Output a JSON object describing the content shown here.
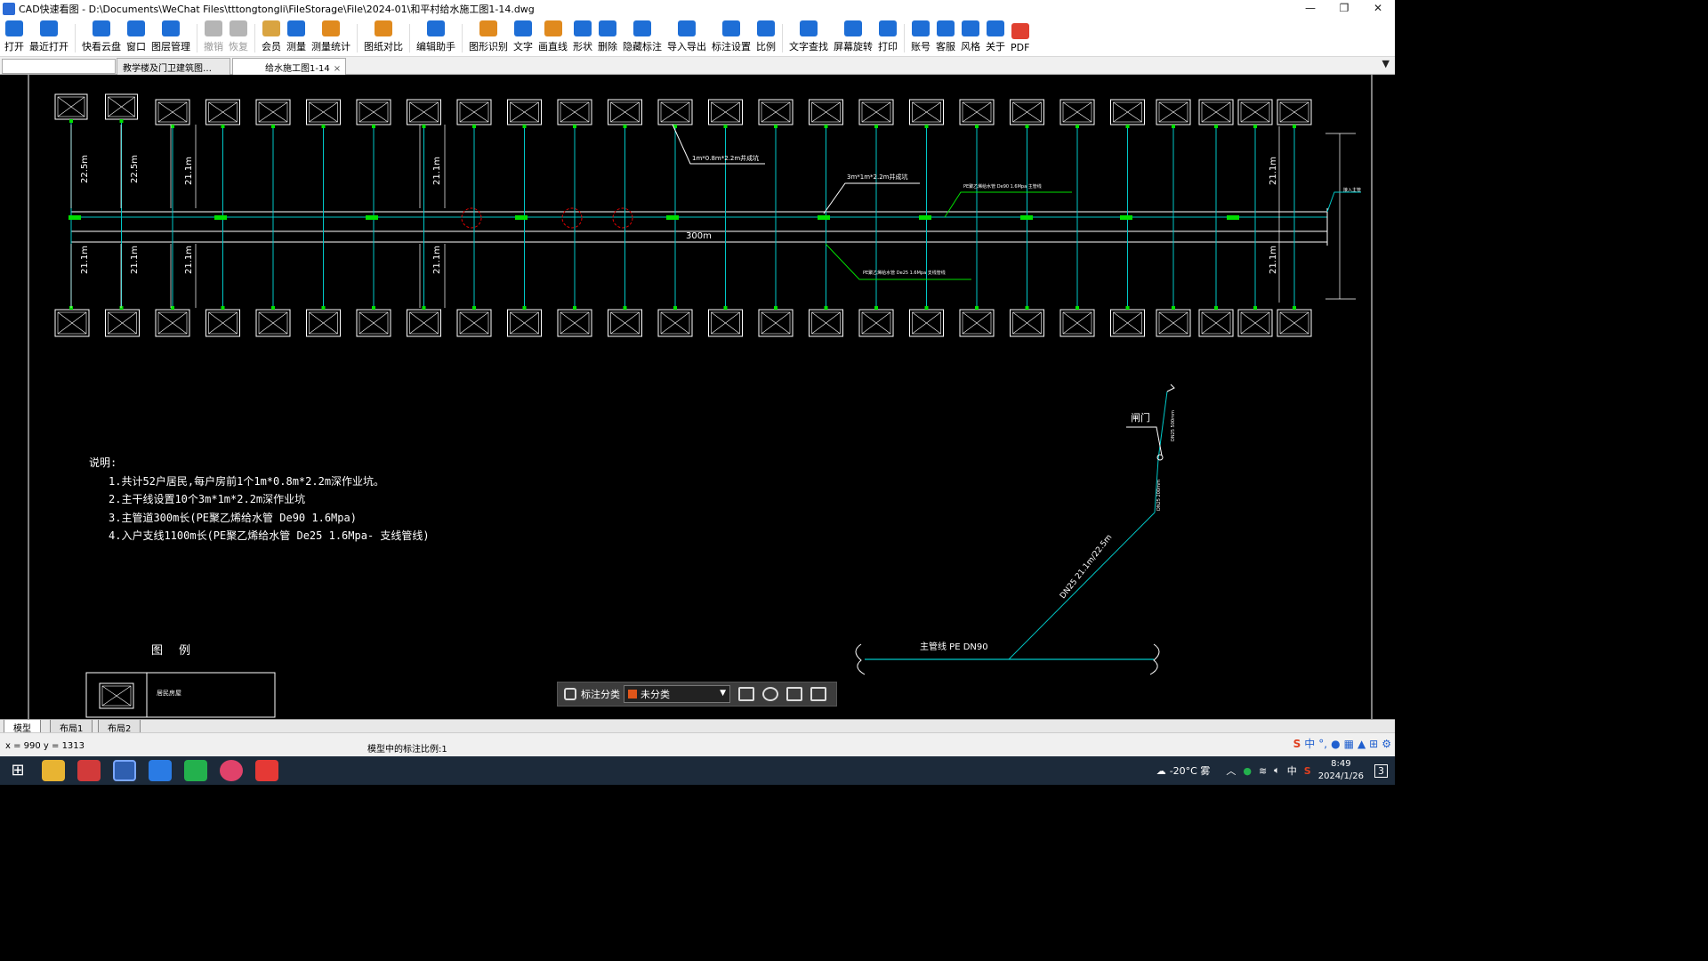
{
  "window": {
    "title": "CAD快速看图 - D:\\Documents\\WeChat Files\\tttongtongli\\FileStorage\\File\\2024-01\\和平村给水施工图1-14.dwg",
    "buttons": [
      "—",
      "❐",
      "✕"
    ]
  },
  "toolbar": [
    {
      "label": "打开",
      "icon": "open-folder-icon",
      "color": "#1e6ed6"
    },
    {
      "label": "最近打开",
      "icon": "recent-clock-icon",
      "color": "#1e6ed6"
    },
    {
      "label": "快看云盘",
      "icon": "cloud-icon",
      "color": "#1e6ed6"
    },
    {
      "label": "窗口",
      "icon": "window-icon",
      "color": "#1e6ed6"
    },
    {
      "label": "图层管理",
      "icon": "layers-icon",
      "color": "#1e6ed6"
    },
    {
      "label": "撤销",
      "icon": "undo-icon",
      "color": "#b5b5b5",
      "disabled": true
    },
    {
      "label": "恢复",
      "icon": "redo-icon",
      "color": "#b5b5b5",
      "disabled": true
    },
    {
      "label": "会员",
      "icon": "vip-icon",
      "color": "#d9a441"
    },
    {
      "label": "测量",
      "icon": "measure-icon",
      "color": "#1e6ed6"
    },
    {
      "label": "测量统计",
      "icon": "measure-stats-icon",
      "color": "#e08a1e"
    },
    {
      "label": "图纸对比",
      "icon": "compare-icon",
      "color": "#e08a1e"
    },
    {
      "label": "编辑助手",
      "icon": "edit-assistant-icon",
      "color": "#1e6ed6"
    },
    {
      "label": "图形识别",
      "icon": "shape-recognize-icon",
      "color": "#e08a1e"
    },
    {
      "label": "文字",
      "icon": "text-icon",
      "color": "#1e6ed6"
    },
    {
      "label": "画直线",
      "icon": "line-icon",
      "color": "#e08a1e"
    },
    {
      "label": "形状",
      "icon": "shape-icon",
      "color": "#1e6ed6"
    },
    {
      "label": "删除",
      "icon": "eraser-icon",
      "color": "#1e6ed6"
    },
    {
      "label": "隐藏标注",
      "icon": "hide-annotation-icon",
      "color": "#1e6ed6"
    },
    {
      "label": "导入导出",
      "icon": "import-export-icon",
      "color": "#1e6ed6"
    },
    {
      "label": "标注设置",
      "icon": "annotation-settings-icon",
      "color": "#1e6ed6"
    },
    {
      "label": "比例",
      "icon": "scale-icon",
      "color": "#1e6ed6"
    },
    {
      "label": "文字查找",
      "icon": "text-search-icon",
      "color": "#1e6ed6"
    },
    {
      "label": "屏幕旋转",
      "icon": "rotate-screen-icon",
      "color": "#1e6ed6"
    },
    {
      "label": "打印",
      "icon": "print-icon",
      "color": "#1e6ed6"
    },
    {
      "label": "账号",
      "icon": "account-icon",
      "color": "#1e6ed6"
    },
    {
      "label": "客服",
      "icon": "headset-icon",
      "color": "#1e6ed6"
    },
    {
      "label": "风格",
      "icon": "style-icon",
      "color": "#1e6ed6"
    },
    {
      "label": "关于",
      "icon": "info-icon",
      "color": "#1e6ed6"
    },
    {
      "label": "PDF",
      "icon": "pdf-icon",
      "color": "#e04030"
    }
  ],
  "tabs": [
    {
      "label": "教学楼及门卫建筑图…",
      "active": false
    },
    {
      "label": "给水施工图1-14",
      "active": true
    }
  ],
  "drawing": {
    "dim_total": "300m",
    "dims_left": [
      "22.5m",
      "22.5m",
      "21.1m",
      "21.1m"
    ],
    "dims_bottom": [
      "21.1m",
      "21.1m",
      "21.1m",
      "21.1m"
    ],
    "dims_right": [
      "21.1m",
      "21.1m"
    ],
    "label_pit_small": "1m*0.8m*2.2m井成坑",
    "label_pit_big": "3m*1m*2.2m井成坑",
    "label_main_pipe": "PE聚乙烯给水管 De90  1.6Mpa 主管线",
    "label_branch_pipe": "PE聚乙烯给水管 De25  1.6Mpa 支线管线",
    "label_right_end": "接入主管",
    "notes_title": "说明:",
    "notes": [
      "1.共计52户居民,每户房前1个1m*0.8m*2.2m深作业坑。",
      "2.主干线设置10个3m*1m*2.2m深作业坑",
      "3.主管道300m长(PE聚乙烯给水管 De90  1.6Mpa)",
      "4.入户支线1100m长(PE聚乙烯给水管 De25  1.6Mpa- 支线管线)"
    ],
    "legend_title": "图例",
    "legend_label": "居民房屋",
    "detail_valve": "闸门",
    "detail_main": "主管线 PE DN90",
    "detail_branch": "DN25 21.1m/22.5m",
    "detail_dn1": "DN25 500mm",
    "detail_dn2": "DN25 200mm",
    "houses_per_row": 26
  },
  "annotation_bar": {
    "label": "标注分类",
    "selected": "未分类",
    "swatch": "#e0561a"
  },
  "layout_tabs": [
    "模型",
    "布局1",
    "布局2"
  ],
  "status": {
    "coords": "x = 990  y = 1313",
    "scale": "模型中的标注比例:1"
  },
  "taskbar": {
    "weather": "-20°C 雾",
    "time": "8:49",
    "date": "2024/1/26",
    "ime": "中",
    "notif_count": "3"
  },
  "colors": {
    "pipe": "#00c8c8",
    "green_marker": "#00e000",
    "red_circle": "#e00000",
    "white_line": "#ffffff"
  }
}
